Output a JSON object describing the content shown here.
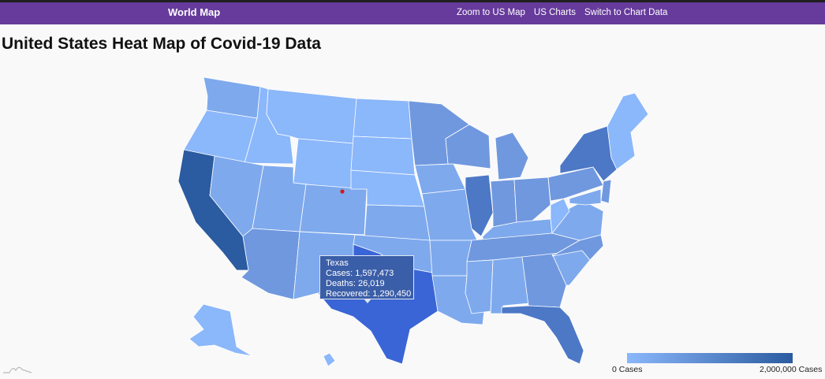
{
  "nav": {
    "brand": "World Map",
    "links": [
      "Zoom to US Map",
      "US Charts",
      "Switch to Chart Data"
    ]
  },
  "page": {
    "title": "United States Heat Map of Covid-19 Data"
  },
  "tooltip": {
    "state": "Texas",
    "cases": "Cases: 1,597,473",
    "deaths": "Deaths: 26,019",
    "recovered": "Recovered: 1,290,450"
  },
  "legend": {
    "min_label": "0 Cases",
    "max_label": "2,000,000 Cases",
    "min_color": "#8bb7fb",
    "max_color": "#2b5ba0"
  },
  "colors": {
    "nav_bg": "#663b9b",
    "low": "#8bb7fb",
    "medium_low": "#7ea9ed",
    "medium": "#7098df",
    "high": "#4c78c6",
    "highest": "#2b5ba0",
    "hovered": "#3a65d6",
    "marker": "#d11a1a"
  },
  "regions": [
    {
      "name": "washington",
      "level": "medium_low"
    },
    {
      "name": "oregon",
      "level": "low"
    },
    {
      "name": "california",
      "level": "highest"
    },
    {
      "name": "idaho",
      "level": "low"
    },
    {
      "name": "nevada",
      "level": "medium_low"
    },
    {
      "name": "montana",
      "level": "low"
    },
    {
      "name": "wyoming",
      "level": "low"
    },
    {
      "name": "utah",
      "level": "medium_low"
    },
    {
      "name": "arizona",
      "level": "medium"
    },
    {
      "name": "colorado",
      "level": "medium_low"
    },
    {
      "name": "new-mexico",
      "level": "medium_low"
    },
    {
      "name": "north-dakota",
      "level": "low"
    },
    {
      "name": "south-dakota",
      "level": "low"
    },
    {
      "name": "nebraska",
      "level": "low"
    },
    {
      "name": "kansas",
      "level": "medium_low"
    },
    {
      "name": "oklahoma",
      "level": "medium_low"
    },
    {
      "name": "texas",
      "level": "hovered"
    },
    {
      "name": "minnesota",
      "level": "medium"
    },
    {
      "name": "iowa",
      "level": "medium_low"
    },
    {
      "name": "missouri",
      "level": "medium_low"
    },
    {
      "name": "arkansas",
      "level": "medium_low"
    },
    {
      "name": "louisiana",
      "level": "medium_low"
    },
    {
      "name": "wisconsin",
      "level": "medium"
    },
    {
      "name": "illinois",
      "level": "high"
    },
    {
      "name": "michigan",
      "level": "medium"
    },
    {
      "name": "indiana",
      "level": "medium"
    },
    {
      "name": "ohio",
      "level": "medium"
    },
    {
      "name": "kentucky",
      "level": "medium_low"
    },
    {
      "name": "tennessee",
      "level": "medium"
    },
    {
      "name": "mississippi",
      "level": "medium_low"
    },
    {
      "name": "alabama",
      "level": "medium_low"
    },
    {
      "name": "georgia",
      "level": "medium"
    },
    {
      "name": "florida",
      "level": "high"
    },
    {
      "name": "south-carolina",
      "level": "medium_low"
    },
    {
      "name": "north-carolina",
      "level": "medium"
    },
    {
      "name": "virginia",
      "level": "medium_low"
    },
    {
      "name": "west-virginia",
      "level": "low"
    },
    {
      "name": "pennsylvania",
      "level": "medium"
    },
    {
      "name": "new-york",
      "level": "high"
    },
    {
      "name": "new-jersey",
      "level": "medium"
    },
    {
      "name": "maryland",
      "level": "medium_low"
    },
    {
      "name": "new-england",
      "level": "low"
    },
    {
      "name": "alaska",
      "level": "low"
    },
    {
      "name": "hawaii",
      "level": "low"
    }
  ]
}
